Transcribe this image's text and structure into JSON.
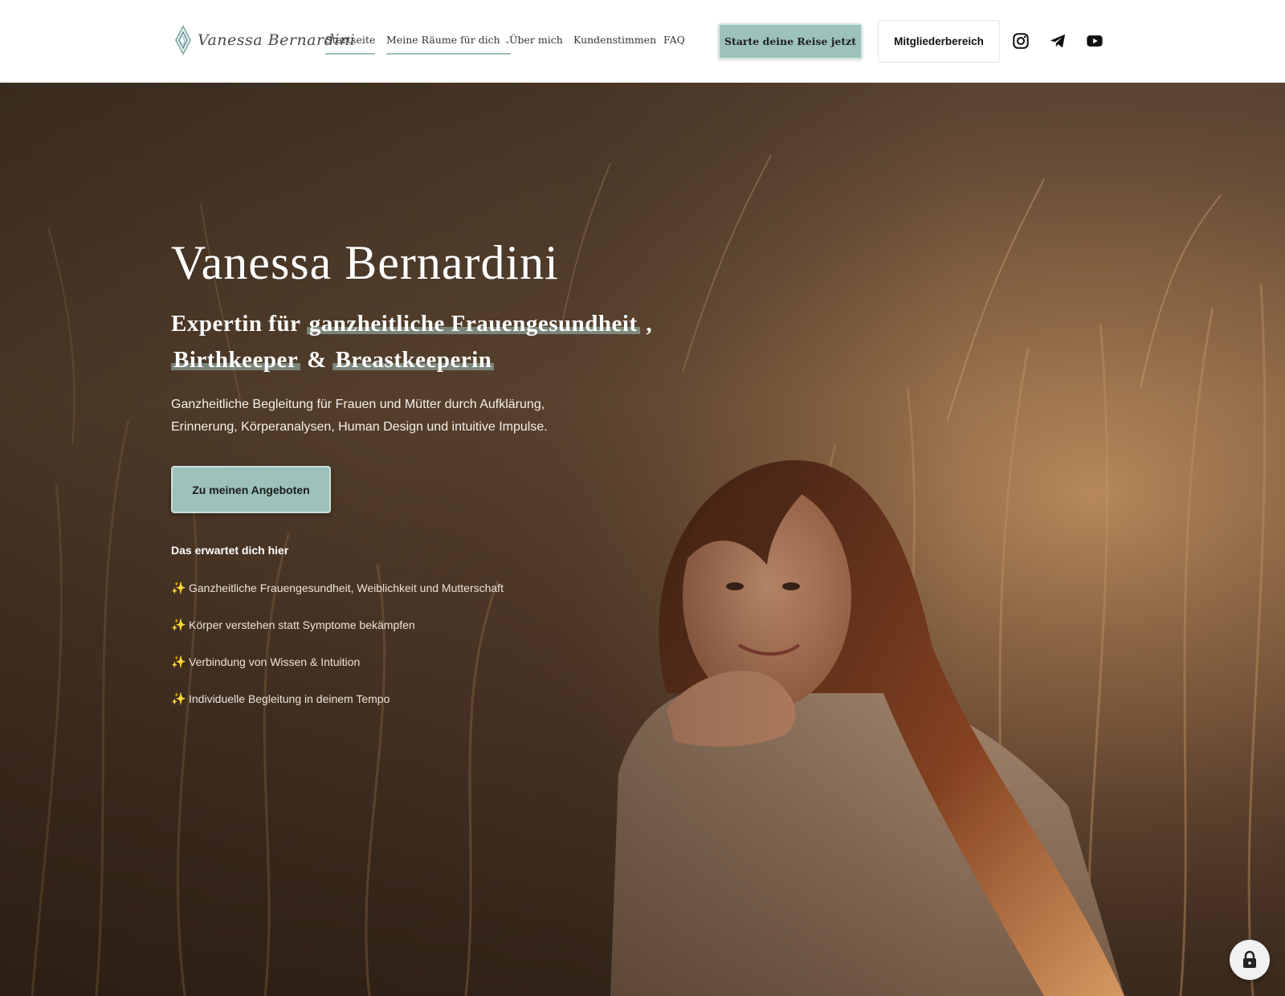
{
  "header": {
    "logo_text": "Vanessa Bernardini",
    "nav": [
      {
        "label": "Startseite",
        "active": true
      },
      {
        "label": "Meine Räume für dich",
        "active": true,
        "has_dropdown": true
      },
      {
        "label": "Über mich",
        "active": false
      },
      {
        "label": "Kundenstimmen",
        "active": false
      },
      {
        "label": "FAQ",
        "active": false
      }
    ],
    "cta_label": "Starte deine Reise jetzt",
    "members_label": "Mitgliederbereich",
    "social_icons": [
      "instagram-icon",
      "telegram-icon",
      "youtube-icon"
    ]
  },
  "hero": {
    "title": "Vanessa Bernardini",
    "subtitle": {
      "prefix": "Expertin für",
      "highlight_1": "ganzheitliche Frauengesundheit",
      "sep_1": ",",
      "highlight_2": "Birthkeeper",
      "sep_2": "&",
      "highlight_3": "Breastkeeperin"
    },
    "description": "Ganzheitliche Begleitung für Frauen und Mütter durch Aufklärung, Erinnerung, Körperanalysen, Human Design und intuitive Impulse.",
    "button_label": "Zu meinen Angeboten",
    "expect_title": "Das erwartet dich hier",
    "expect_items": [
      "Ganzheitliche Frauengesundheit, Weiblichkeit und Mutterschaft",
      "Körper verstehen statt Symptome bekämpfen",
      "Verbindung von Wissen & Intuition",
      "Individuelle Begleitung in deinem Tempo"
    ]
  },
  "colors": {
    "accent": "#9cc2ba",
    "header_bg": "#ffffff",
    "hero_text": "#ffffff"
  },
  "icons": {
    "sparkle": "✨",
    "lock": "lock-icon"
  }
}
